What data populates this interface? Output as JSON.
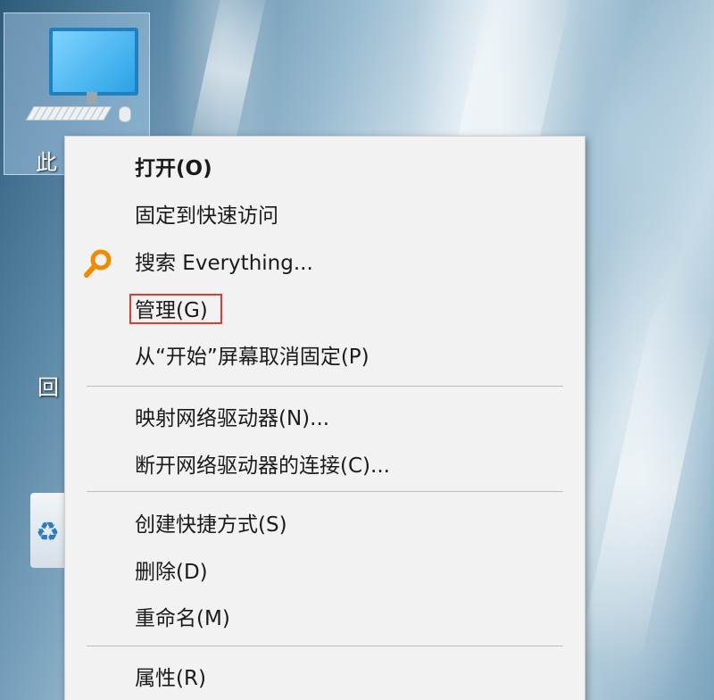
{
  "desktop": {
    "icons": [
      {
        "label": "此",
        "icon": "computer-icon",
        "selected": true
      },
      {
        "label": "回",
        "icon": "recycle-bin-icon",
        "selected": false
      }
    ]
  },
  "context_menu": {
    "items": [
      {
        "label": "打开(O)",
        "bold": true
      },
      {
        "label": "固定到快速访问"
      },
      {
        "label": "搜索 Everything...",
        "icon": "magnifier-icon",
        "icon_color": "#f08a00"
      },
      {
        "label": "管理(G)",
        "highlighted": true,
        "highlight_color": "#e53935"
      },
      {
        "label": "从“开始”屏幕取消固定(P)"
      },
      {
        "separator": true
      },
      {
        "label": "映射网络驱动器(N)..."
      },
      {
        "label": "断开网络驱动器的连接(C)..."
      },
      {
        "separator": true
      },
      {
        "label": "创建快捷方式(S)"
      },
      {
        "label": "删除(D)"
      },
      {
        "label": "重命名(M)"
      },
      {
        "separator": true
      },
      {
        "label": "属性(R)"
      }
    ]
  }
}
